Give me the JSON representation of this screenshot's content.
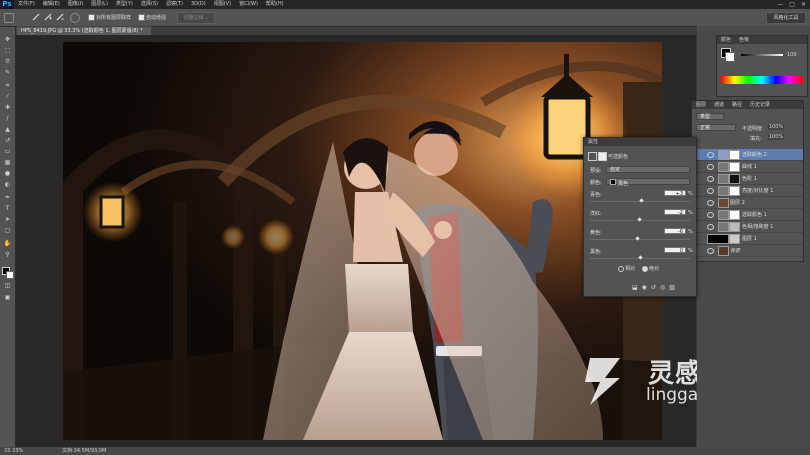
{
  "app": {
    "logo": "Ps"
  },
  "menu": [
    "文件(F)",
    "编辑(E)",
    "图像(I)",
    "图层(L)",
    "类型(Y)",
    "选择(S)",
    "滤镜(T)",
    "3D(D)",
    "视图(V)",
    "窗口(W)",
    "帮助(H)"
  ],
  "window_controls": [
    "—",
    "□",
    "✕"
  ],
  "options_bar": {
    "sample_all_label": "对所有图层取样",
    "auto_enhance_label": "自动增强",
    "refine_edge": "调整边缘...",
    "workspace": "风格化工具"
  },
  "document": {
    "tab": "HPS_8419.JPG @ 33.3% (选取颜色 1, 图层蒙版/8) *"
  },
  "status": {
    "zoom": "33.33%",
    "doc": "文档:34.5M/93.0M"
  },
  "color_panel": {
    "tabs": [
      "颜色",
      "色板"
    ],
    "value": "100"
  },
  "layers_panel": {
    "tabs": [
      "图层",
      "通道",
      "路径",
      "历史记录"
    ],
    "kind": "类型",
    "blend": "正常",
    "opacity_label": "不透明度:",
    "opacity": "100%",
    "fill_label": "填充:",
    "fill": "100%",
    "layers": [
      {
        "name": "选取颜色 2",
        "selected": true
      },
      {
        "name": "曲线 1",
        "selected": false
      },
      {
        "name": "色阶 1",
        "selected": false
      },
      {
        "name": "亮度/对比度 1",
        "selected": false
      },
      {
        "name": "图层 2",
        "selected": false
      },
      {
        "name": "选取颜色 1",
        "selected": false
      },
      {
        "name": "色相/饱和度 1",
        "selected": false
      },
      {
        "name": "图层 1",
        "selected": false
      },
      {
        "name": "背景",
        "selected": false
      }
    ]
  },
  "properties_panel": {
    "tab": "属性",
    "title": "可选颜色",
    "preset_label": "预设:",
    "preset": "自定",
    "colors_label": "颜色:",
    "colors": "黑色",
    "sliders": [
      {
        "label": "青色:",
        "value": "+3",
        "pct": "%",
        "pos": 0.515
      },
      {
        "label": "洋红:",
        "value": "-2",
        "pct": "%",
        "pos": 0.49
      },
      {
        "label": "黄色:",
        "value": "-6",
        "pct": "%",
        "pos": 0.47
      },
      {
        "label": "黑色:",
        "value": "0",
        "pct": "%",
        "pos": 0.5
      }
    ],
    "relative_label": "相对",
    "absolute_label": "绝对"
  },
  "watermark": {
    "cn": "灵感中国",
    "url": "lingganchina.com"
  }
}
